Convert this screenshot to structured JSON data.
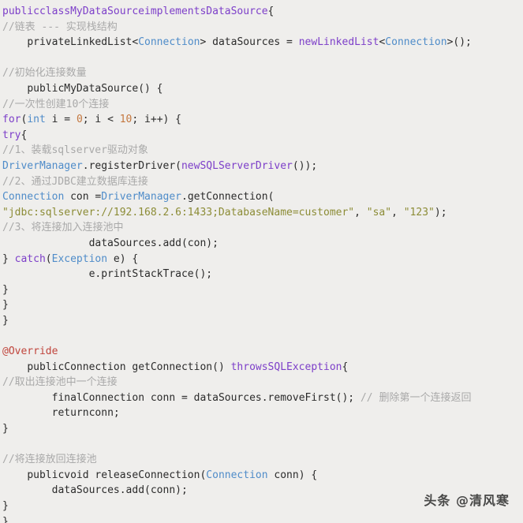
{
  "editor": {
    "background_color": "#efeeec",
    "default_text_color": "#2b2b2b",
    "language": "java",
    "colors": {
      "keyword": "#7d3fc9",
      "type": "#4f8cc9",
      "string": "#8c8c36",
      "number": "#c4773f",
      "comment": "#a9a9a9",
      "annotation": "#c0453c",
      "plain": "#2b2b2b"
    },
    "lines": [
      {
        "id": "l1",
        "indent": "",
        "tokens": [
          {
            "t": "publicclassMyDataSourceimplementsDataSource",
            "c": "kw"
          },
          {
            "t": "{",
            "c": "pln"
          }
        ]
      },
      {
        "id": "l2",
        "indent": "",
        "tokens": [
          {
            "t": "//链表 --- 实现栈结构",
            "c": "cmt"
          }
        ]
      },
      {
        "id": "l3",
        "indent": "    ",
        "tokens": [
          {
            "t": "privateLinkedList",
            "c": "pln"
          },
          {
            "t": "<",
            "c": "pln"
          },
          {
            "t": "Connection",
            "c": "typ"
          },
          {
            "t": "> dataSources = ",
            "c": "pln"
          },
          {
            "t": "newLinkedList",
            "c": "kw"
          },
          {
            "t": "<",
            "c": "pln"
          },
          {
            "t": "Connection",
            "c": "typ"
          },
          {
            "t": ">();",
            "c": "pln"
          }
        ]
      },
      {
        "id": "l4",
        "indent": "",
        "tokens": []
      },
      {
        "id": "l5",
        "indent": "",
        "tokens": [
          {
            "t": "//初始化连接数量",
            "c": "cmt"
          }
        ]
      },
      {
        "id": "l6",
        "indent": "    ",
        "tokens": [
          {
            "t": "publicMyDataSource() {",
            "c": "pln"
          }
        ]
      },
      {
        "id": "l7",
        "indent": "",
        "tokens": [
          {
            "t": "//一次性创建10个连接",
            "c": "cmt"
          }
        ]
      },
      {
        "id": "l8",
        "indent": "",
        "tokens": [
          {
            "t": "for",
            "c": "kw"
          },
          {
            "t": "(",
            "c": "pln"
          },
          {
            "t": "int",
            "c": "typ"
          },
          {
            "t": " i = ",
            "c": "pln"
          },
          {
            "t": "0",
            "c": "num"
          },
          {
            "t": "; i < ",
            "c": "pln"
          },
          {
            "t": "10",
            "c": "num"
          },
          {
            "t": "; i++) {",
            "c": "pln"
          }
        ]
      },
      {
        "id": "l9",
        "indent": "",
        "tokens": [
          {
            "t": "try",
            "c": "kw"
          },
          {
            "t": "{",
            "c": "pln"
          }
        ]
      },
      {
        "id": "l10",
        "indent": "",
        "tokens": [
          {
            "t": "//1、装载sqlserver驱动对象",
            "c": "cmt"
          }
        ]
      },
      {
        "id": "l11",
        "indent": "",
        "tokens": [
          {
            "t": "DriverManager",
            "c": "typ"
          },
          {
            "t": ".registerDriver(",
            "c": "pln"
          },
          {
            "t": "newSQLServerDriver",
            "c": "kw"
          },
          {
            "t": "());",
            "c": "pln"
          }
        ]
      },
      {
        "id": "l12",
        "indent": "",
        "tokens": [
          {
            "t": "//2、通过JDBC建立数据库连接",
            "c": "cmt"
          }
        ]
      },
      {
        "id": "l13",
        "indent": "",
        "tokens": [
          {
            "t": "Connection",
            "c": "typ"
          },
          {
            "t": " con =",
            "c": "pln"
          },
          {
            "t": "DriverManager",
            "c": "typ"
          },
          {
            "t": ".getConnection(",
            "c": "pln"
          }
        ]
      },
      {
        "id": "l14",
        "indent": "",
        "tokens": [
          {
            "t": "\"jdbc:sqlserver://192.168.2.6:1433;DatabaseName=customer\"",
            "c": "str"
          },
          {
            "t": ", ",
            "c": "pln"
          },
          {
            "t": "\"sa\"",
            "c": "str"
          },
          {
            "t": ", ",
            "c": "pln"
          },
          {
            "t": "\"123\"",
            "c": "str"
          },
          {
            "t": ");",
            "c": "pln"
          }
        ]
      },
      {
        "id": "l15",
        "indent": "",
        "tokens": [
          {
            "t": "//3、将连接加入连接池中",
            "c": "cmt"
          }
        ]
      },
      {
        "id": "l16",
        "indent": "              ",
        "tokens": [
          {
            "t": "dataSources.add(con);",
            "c": "pln"
          }
        ]
      },
      {
        "id": "l17",
        "indent": "",
        "tokens": [
          {
            "t": "} ",
            "c": "pln"
          },
          {
            "t": "catch",
            "c": "kw"
          },
          {
            "t": "(",
            "c": "pln"
          },
          {
            "t": "Exception",
            "c": "typ"
          },
          {
            "t": " e) {",
            "c": "pln"
          }
        ]
      },
      {
        "id": "l18",
        "indent": "              ",
        "tokens": [
          {
            "t": "e.printStackTrace();",
            "c": "pln"
          }
        ]
      },
      {
        "id": "l19",
        "indent": "",
        "tokens": [
          {
            "t": "}",
            "c": "pln"
          }
        ]
      },
      {
        "id": "l20",
        "indent": "",
        "tokens": [
          {
            "t": "}",
            "c": "pln"
          }
        ]
      },
      {
        "id": "l21",
        "indent": "",
        "tokens": [
          {
            "t": "}",
            "c": "pln"
          }
        ]
      },
      {
        "id": "l22",
        "indent": "",
        "tokens": []
      },
      {
        "id": "l23",
        "indent": "",
        "tokens": [
          {
            "t": "@Override",
            "c": "ann"
          }
        ]
      },
      {
        "id": "l24",
        "indent": "    ",
        "tokens": [
          {
            "t": "publicConnection getConnection() ",
            "c": "pln"
          },
          {
            "t": "throwsSQLException",
            "c": "kw"
          },
          {
            "t": "{",
            "c": "pln"
          }
        ]
      },
      {
        "id": "l25",
        "indent": "",
        "tokens": [
          {
            "t": "//取出连接池中一个连接",
            "c": "cmt"
          }
        ]
      },
      {
        "id": "l26",
        "indent": "        ",
        "tokens": [
          {
            "t": "finalConnection conn = dataSources.removeFirst(); ",
            "c": "pln"
          },
          {
            "t": "// 删除第一个连接返回",
            "c": "cmt"
          }
        ]
      },
      {
        "id": "l27",
        "indent": "        ",
        "tokens": [
          {
            "t": "returnconn;",
            "c": "pln"
          }
        ]
      },
      {
        "id": "l28",
        "indent": "",
        "tokens": [
          {
            "t": "}",
            "c": "pln"
          }
        ]
      },
      {
        "id": "l29",
        "indent": "",
        "tokens": []
      },
      {
        "id": "l30",
        "indent": "",
        "tokens": [
          {
            "t": "//将连接放回连接池",
            "c": "cmt"
          }
        ]
      },
      {
        "id": "l31",
        "indent": "    ",
        "tokens": [
          {
            "t": "publicvoid releaseConnection(",
            "c": "pln"
          },
          {
            "t": "Connection",
            "c": "typ"
          },
          {
            "t": " conn) {",
            "c": "pln"
          }
        ]
      },
      {
        "id": "l32",
        "indent": "        ",
        "tokens": [
          {
            "t": "dataSources.add(conn);",
            "c": "pln"
          }
        ]
      },
      {
        "id": "l33",
        "indent": "",
        "tokens": [
          {
            "t": "}",
            "c": "pln"
          }
        ]
      },
      {
        "id": "l34",
        "indent": "",
        "tokens": [
          {
            "t": "}",
            "c": "pln"
          }
        ]
      }
    ]
  },
  "watermark": {
    "text": "头条 @清风寒"
  }
}
